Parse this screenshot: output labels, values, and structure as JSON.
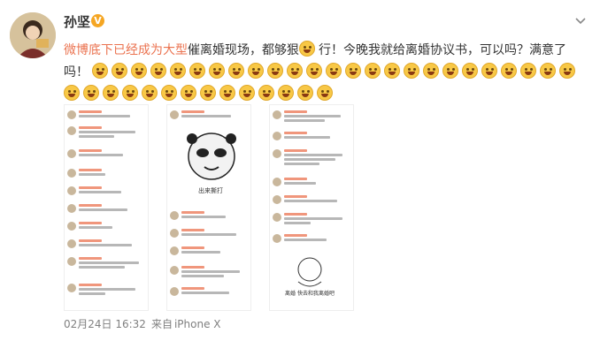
{
  "post": {
    "author": "孙坚",
    "verified_badge": "V",
    "topic_link": "微博底下已经成为大型",
    "text_part1": "催离婚现场，都够狠",
    "text_part2": "行！今晚我就给离婚协议书，可以吗？满意了吗！",
    "emoji_count": 39,
    "emoji_name": "smile-emoji",
    "timestamp": "02月24日 16:32",
    "source_prefix": "来自",
    "source_device": "iPhone X"
  },
  "media": {
    "sticker_caption": "出来撕打",
    "note_caption": "离婚 快去和我离婚吧"
  },
  "colors": {
    "topic": "#eb7350",
    "text": "#333333",
    "meta": "#808080",
    "badge": "#f5a623"
  }
}
